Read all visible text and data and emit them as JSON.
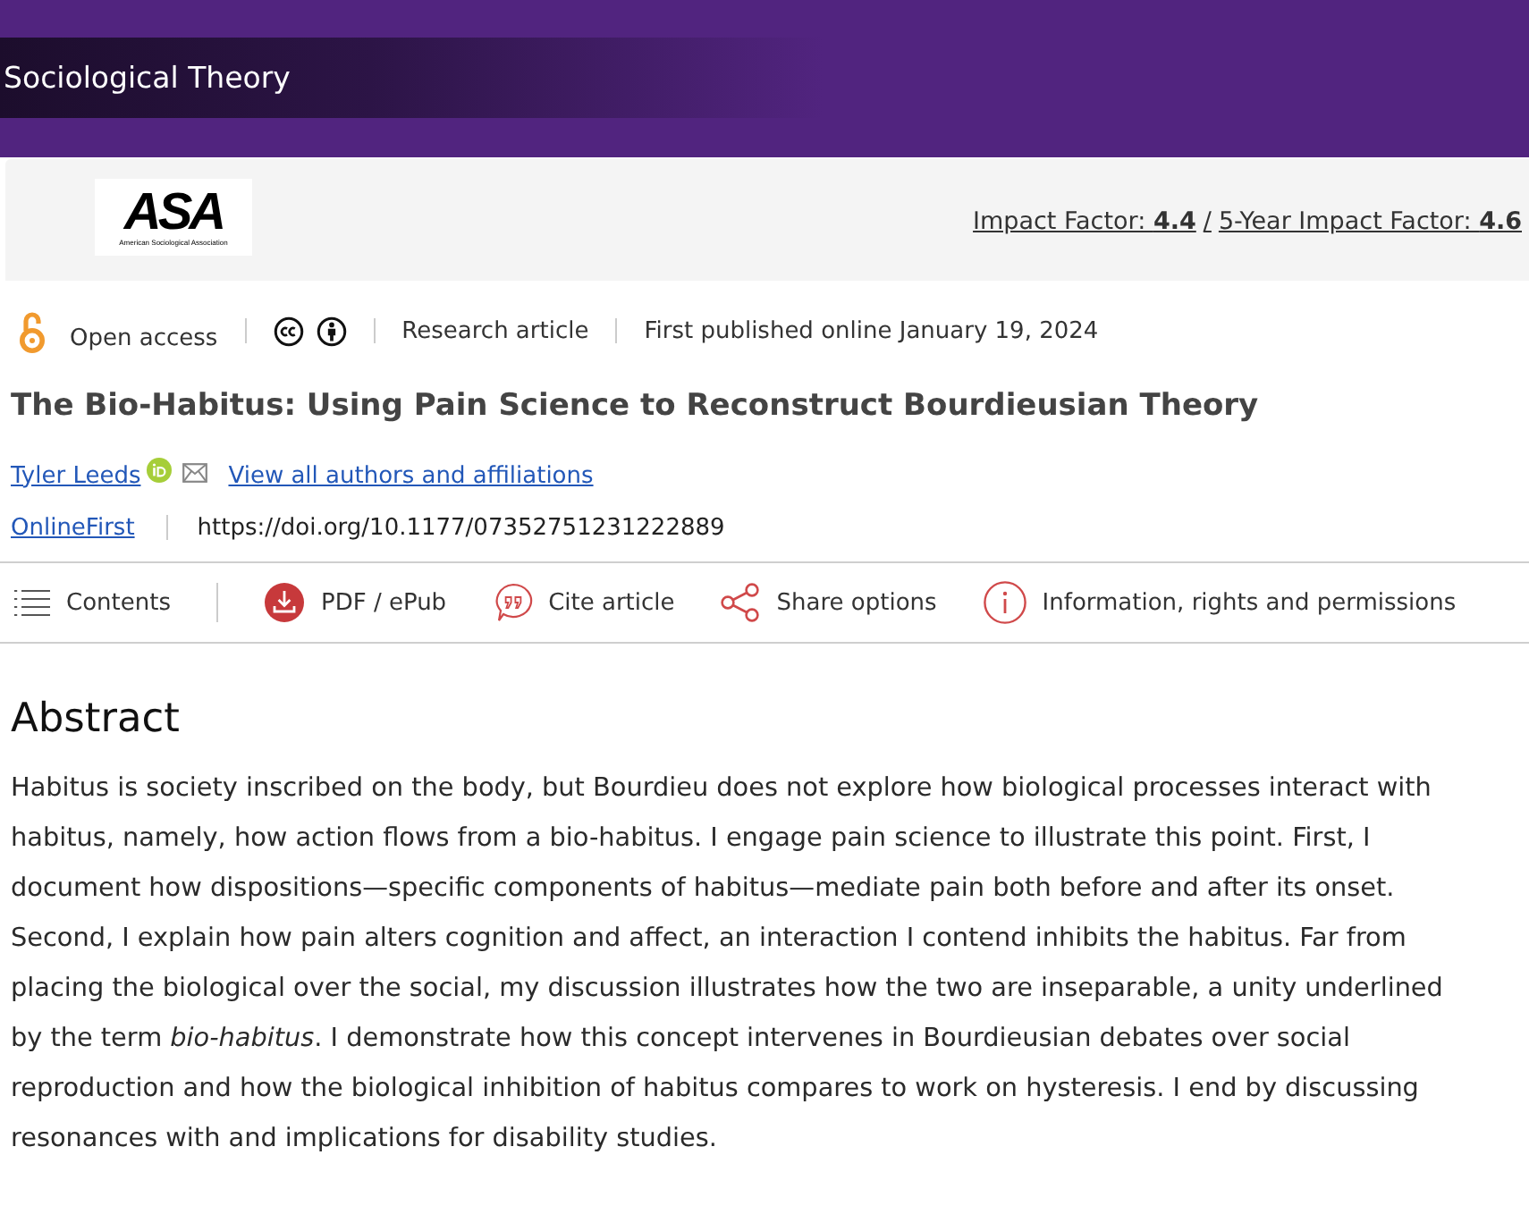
{
  "journal": {
    "title": "Sociological Theory"
  },
  "publisher_bar": {
    "logo": {
      "wordmark": "ASA",
      "subtitle": "American Sociological Association"
    },
    "impact_factors": [
      "Impact Factor: **4.4**",
      "5-Year Impact Factor: **4.6**"
    ],
    "separator": "/"
  },
  "meta": {
    "access": "Open access",
    "article_type": "Research article",
    "published": "First published online January 19, 2024"
  },
  "article": {
    "title": "The Bio-Habitus: Using Pain Science to Reconstruct Bourdieusian Theory",
    "authors": [
      {
        "name": "Tyler Leeds"
      }
    ],
    "all_authors_link": "View all authors and affiliations",
    "status": "OnlineFirst",
    "doi": "https://doi.org/10.1177/07352751231222889"
  },
  "toolbar": [
    {
      "kind": "contents",
      "label": "Contents"
    },
    {
      "kind": "download",
      "label": "PDF / ePub"
    },
    {
      "kind": "cite",
      "label": "Cite article"
    },
    {
      "kind": "share",
      "label": "Share options"
    },
    {
      "kind": "info",
      "label": "Information, rights and permissions"
    }
  ],
  "abstract": {
    "heading": "Abstract",
    "text": "Habitus is society inscribed on the body, but Bourdieu does not explore how biological processes interact with habitus, namely, how action flows from a bio-habitus. I engage pain science to illustrate this point. First, I document how dispositions—specific components of habitus—mediate pain both before and after its onset. Second, I explain how pain alters cognition and affect, an interaction I contend inhibits the habitus. Far from placing the biological over the social, my discussion illustrates how the two are inseparable, a unity underlined by the term *bio-habitus*. I demonstrate how this concept intervenes in Bourdieusian debates over social reproduction and how the biological inhibition of habitus compares to work on hysteresis. I end by discussing resonances with and implications for disability studies."
  }
}
